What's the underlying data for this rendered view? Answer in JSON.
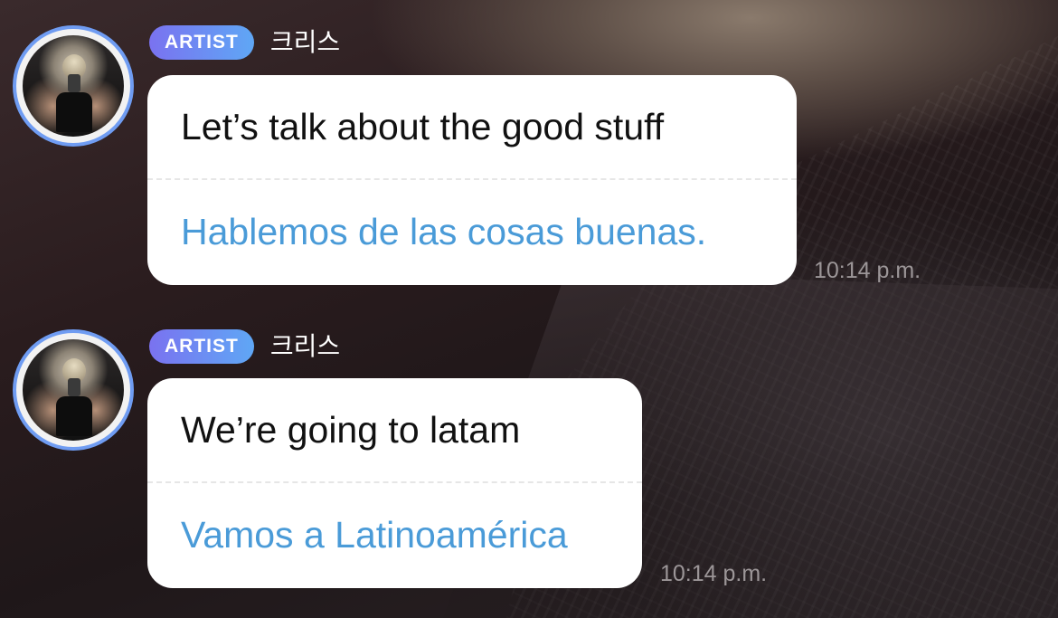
{
  "messages": [
    {
      "badge": "ARTIST",
      "sender": "크리스",
      "text": "Let’s talk about the good stuff",
      "translation": "Hablemos de las cosas buenas.",
      "time": "10:14 p.m."
    },
    {
      "badge": "ARTIST",
      "sender": "크리스",
      "text": "We’re going to latam",
      "translation": "Vamos a Latinoamérica",
      "time": "10:14 p.m."
    }
  ],
  "colors": {
    "badge_gradient_start": "#7a72f0",
    "badge_gradient_end": "#5fa7f5",
    "avatar_ring": "#6f9cf2",
    "translation_text": "#4a9bd8",
    "bubble_background": "#ffffff",
    "timestamp": "#9c9698"
  },
  "icons": {
    "avatar": "artist-profile-photo"
  }
}
